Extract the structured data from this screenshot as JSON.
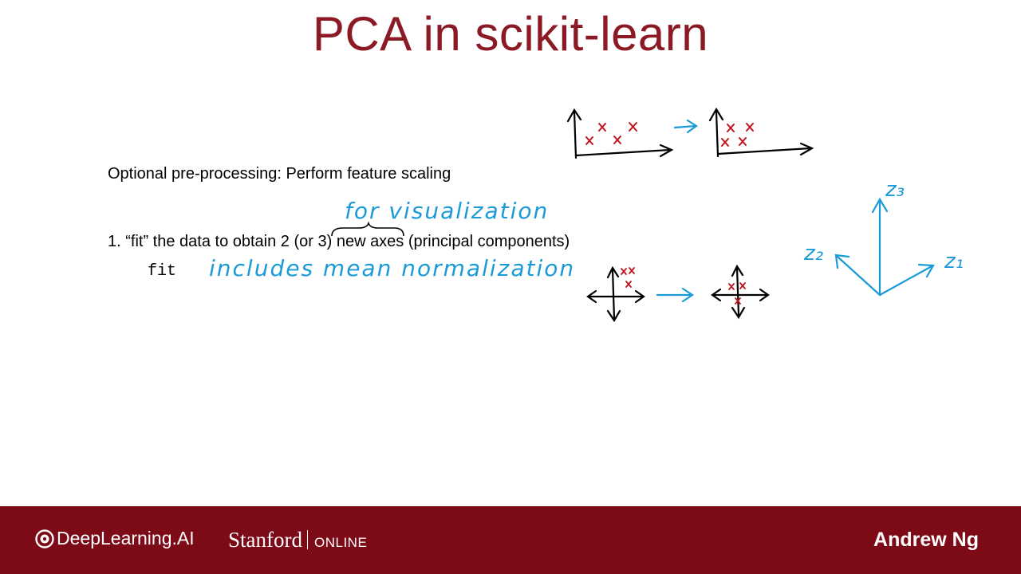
{
  "slide": {
    "title": "PCA in scikit-learn",
    "preprocessing_text": "Optional pre-processing: Perform feature scaling",
    "step1_text": "1. “fit” the data to obtain 2 (or 3) new axes (principal components)",
    "fit_code": "fit"
  },
  "annotations": {
    "for_visualization": "for visualization",
    "includes_mean_normalization": "includes mean normalization",
    "z1": "z₁",
    "z2": "z₂",
    "z3": "z₃",
    "ink_color": "#1a9ad6",
    "marker_color": "#c0141e"
  },
  "footer": {
    "deeplearning_label": "DeepLearning.AI",
    "stanford_label": "Stanford",
    "online_label": "ONLINE",
    "author": "Andrew Ng",
    "background_color": "#7d0a17"
  },
  "theme": {
    "title_color": "#8b1a24"
  }
}
